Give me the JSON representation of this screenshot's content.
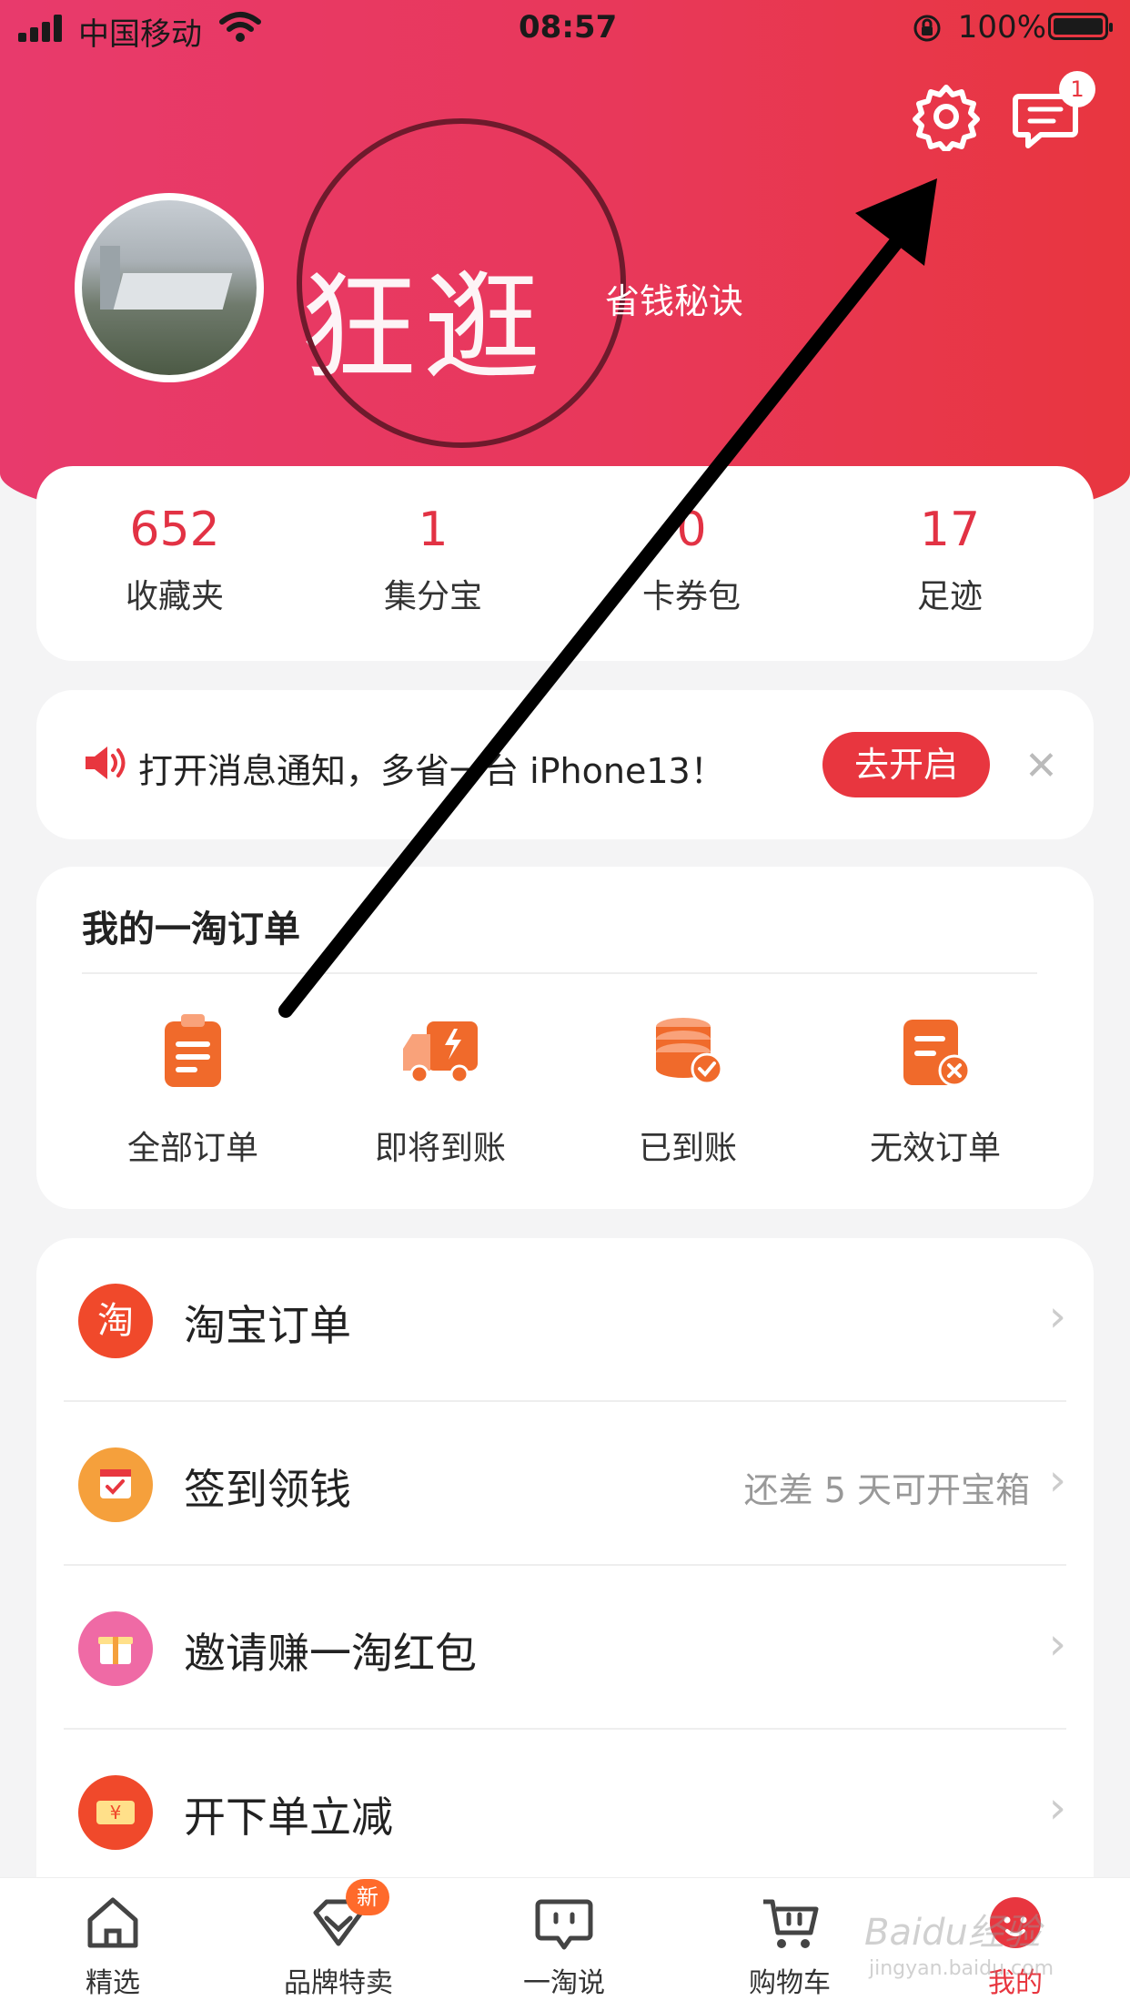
{
  "status": {
    "carrier": "中国移动",
    "time": "08:57",
    "battery": "100%"
  },
  "header": {
    "nickname": "狂逛",
    "tagline": "省钱秘诀",
    "message_badge": "1"
  },
  "stats": [
    {
      "value": "652",
      "label": "收藏夹"
    },
    {
      "value": "1",
      "label": "集分宝"
    },
    {
      "value": "0",
      "label": "卡券包"
    },
    {
      "value": "17",
      "label": "足迹"
    }
  ],
  "notice": {
    "text": "打开消息通知，多省一台 iPhone13！",
    "button": "去开启"
  },
  "orders": {
    "title": "我的一淘订单",
    "items": [
      {
        "label": "全部订单",
        "icon": "clipboard-icon"
      },
      {
        "label": "即将到账",
        "icon": "truck-icon"
      },
      {
        "label": "已到账",
        "icon": "coins-check-icon"
      },
      {
        "label": "无效订单",
        "icon": "invalid-order-icon"
      }
    ]
  },
  "menu": [
    {
      "label": "淘宝订单",
      "icon_text": "淘",
      "color": "#f0492b",
      "sub": ""
    },
    {
      "label": "签到领钱",
      "icon_text": "",
      "color": "#f5a03c",
      "sub": "还差 5 天可开宝箱"
    },
    {
      "label": "邀请赚一淘红包",
      "icon_text": "",
      "color": "#ef6aa5",
      "sub": ""
    },
    {
      "label": "开下单立减",
      "icon_text": "¥",
      "color": "#f0492b",
      "sub": ""
    }
  ],
  "tabbar": [
    {
      "label": "精选",
      "icon": "home-icon"
    },
    {
      "label": "品牌特卖",
      "icon": "diamond-icon",
      "badge": "新"
    },
    {
      "label": "一淘说",
      "icon": "chat-icon"
    },
    {
      "label": "购物车",
      "icon": "cart-icon"
    },
    {
      "label": "我的",
      "icon": "profile-icon"
    }
  ],
  "colors": {
    "accent": "#e8363f",
    "header_start": "#e83a6c",
    "header_end": "#e8363f"
  },
  "watermark": {
    "brand": "Baidu经验",
    "url": "jingyan.baidu.com"
  }
}
